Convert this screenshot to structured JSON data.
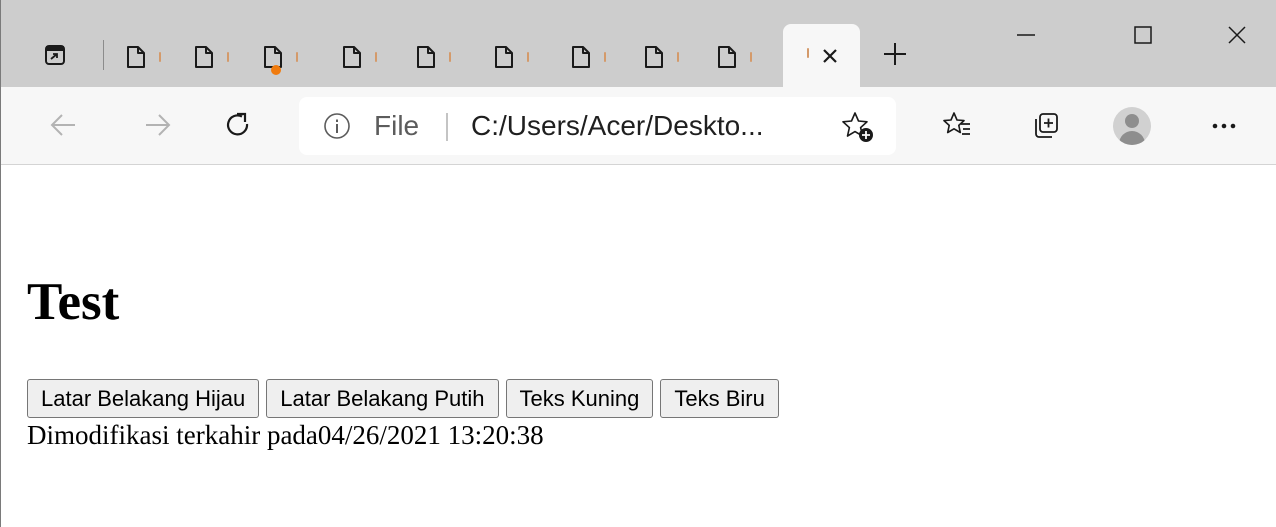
{
  "browser": {
    "tab_count_minimized": 9,
    "omnibox": {
      "scheme_label": "File",
      "url_text": "C:/Users/Acer/Deskto..."
    }
  },
  "page": {
    "heading": "Test",
    "buttons": [
      {
        "label": "Latar Belakang Hijau"
      },
      {
        "label": "Latar Belakang Putih"
      },
      {
        "label": "Teks Kuning"
      },
      {
        "label": "Teks Biru"
      }
    ],
    "modified_text": "Dimodifikasi terkahir pada04/26/2021 13:20:38"
  },
  "colors": {
    "tabstrip": "#cdcdcd",
    "toolbar": "#f7f7f7",
    "audio_dot": "#f07b0e",
    "button_bg": "#efefef"
  },
  "icons": [
    "tab-actions-icon",
    "page-icon",
    "close-icon",
    "plus-icon",
    "minimize-icon",
    "maximize-icon",
    "window-close-icon",
    "back-arrow-icon",
    "forward-arrow-icon",
    "refresh-icon",
    "info-icon",
    "add-favorite-icon",
    "favorites-icon",
    "collections-icon",
    "profile-icon",
    "more-icon"
  ]
}
